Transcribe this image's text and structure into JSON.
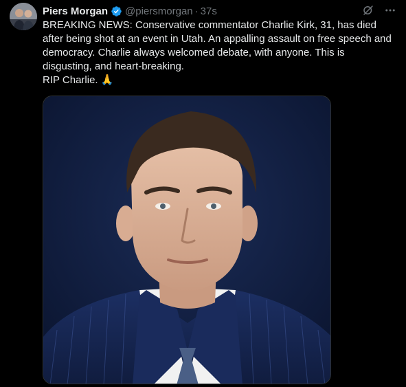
{
  "post": {
    "author_name": "Piers Morgan",
    "handle": "@piersmorgan",
    "separator": "·",
    "time": "37s",
    "text_main": "BREAKING NEWS: Conservative commentator Charlie Kirk, 31, has died after being shot at an event in Utah. An appalling assault on free speech and democracy. Charlie always welcomed debate, with anyone. This is disgusting, and heart-breaking.",
    "text_closing": "RIP Charlie. 🙏",
    "verified": true,
    "media": {
      "subject": "photo-portrait",
      "background_color": "#0f1c3d"
    }
  },
  "icons": {
    "verified": "verified-badge-icon",
    "grok": "grok-icon",
    "more": "more-icon"
  },
  "colors": {
    "background": "#000000",
    "text_primary": "#e7e9ea",
    "text_secondary": "#71767b",
    "accent": "#1d9bf0"
  }
}
